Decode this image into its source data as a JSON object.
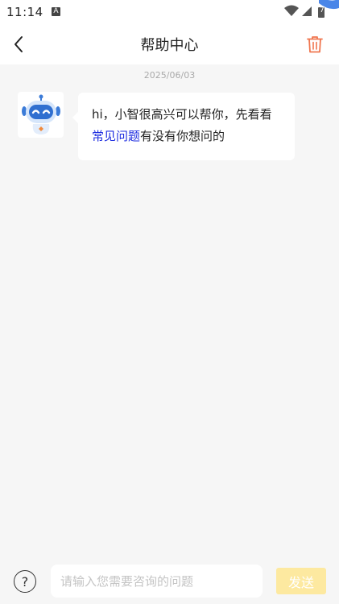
{
  "status_bar": {
    "time": "11:14",
    "notification_icon": "a-letter-icon",
    "battery_label": "7"
  },
  "header": {
    "title": "帮助中心",
    "back_icon": "chevron-left-icon",
    "trash_icon": "trash-icon",
    "trash_color": "#f0764f"
  },
  "chat": {
    "date": "2025/06/03",
    "messages": [
      {
        "sender": "bot",
        "avatar_icon": "robot-icon",
        "text_before": "hi，小智很高兴可以帮你，先看看",
        "link_text": "常见问题",
        "text_after": "有没有你想问的"
      }
    ]
  },
  "bottom": {
    "help_label": "?",
    "input_placeholder": "请输入您需要咨询的问题",
    "input_value": "",
    "send_label": "发送",
    "send_color": "#fde9a0"
  }
}
